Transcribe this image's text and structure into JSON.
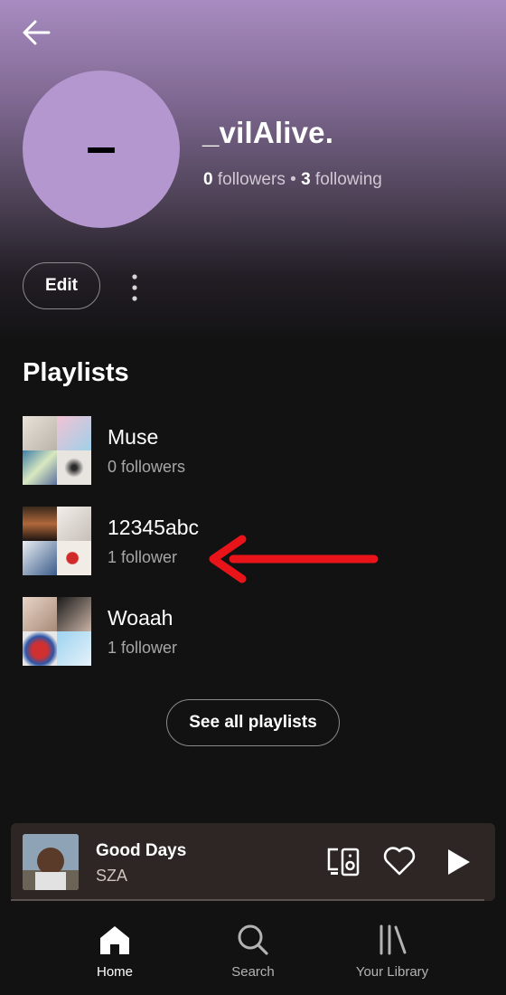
{
  "profile": {
    "avatar_text": "–",
    "username": "_vilAlive.",
    "followers_count": "0",
    "followers_label": "followers",
    "separator": "•",
    "following_count": "3",
    "following_label": "following",
    "edit_label": "Edit"
  },
  "playlists": {
    "title": "Playlists",
    "items": [
      {
        "name": "Muse",
        "meta": "0 followers"
      },
      {
        "name": "12345abc",
        "meta": "1 follower"
      },
      {
        "name": "Woaah",
        "meta": "1 follower"
      }
    ],
    "see_all_label": "See all playlists"
  },
  "now_playing": {
    "title": "Good Days",
    "artist": "SZA"
  },
  "nav": {
    "home": "Home",
    "search": "Search",
    "library": "Your Library"
  },
  "colors": {
    "annotation_arrow": "#e8141a",
    "avatar": "#b497cf",
    "now_playing_bg": "#2e2624"
  },
  "icons": [
    "back-arrow-icon",
    "more-vertical-icon",
    "device-icon",
    "heart-icon",
    "play-icon",
    "home-icon",
    "search-icon",
    "library-icon"
  ]
}
